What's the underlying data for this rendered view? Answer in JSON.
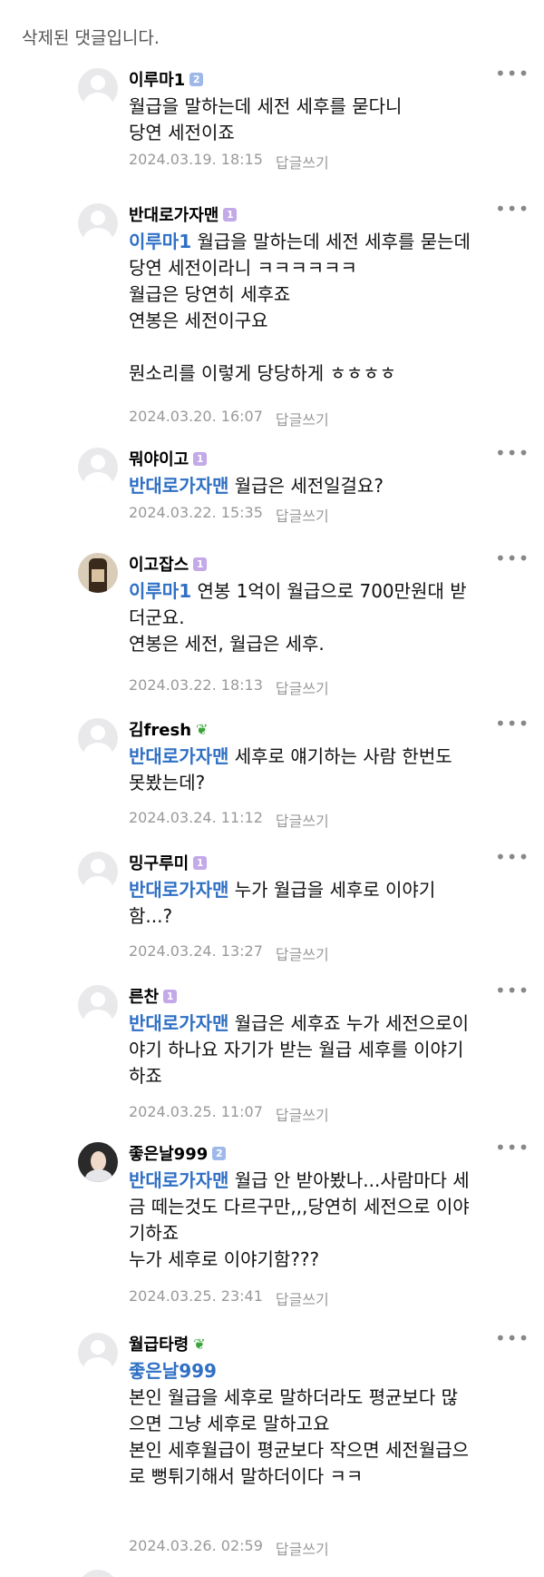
{
  "deleted_notice": "삭제된 댓글입니다.",
  "more_label": "•••",
  "reply_label": "답글쓰기",
  "comments": [
    {
      "nick": "이루마1",
      "badge": "2",
      "mention": "",
      "text": "월급을 말하는데 세전 세후를 묻다니\n당연 세전이죠",
      "date": "2024.03.19. 18:15"
    },
    {
      "nick": "반대로가자맨",
      "badge": "1",
      "mention": "이루마1",
      "text": " 월급을 말하는데 세전 세후를 묻는데\n당연 세전이라니 ㅋㅋㅋㅋㅋㅋ\n월급은 당연히 세후죠\n연봉은 세전이구요\n\n뭔소리를 이렇게 당당하게 ㅎㅎㅎㅎ",
      "date": "2024.03.20. 16:07"
    },
    {
      "nick": "뭐야이고",
      "badge": "1",
      "mention": "반대로가자맨",
      "text": " 월급은 세전일걸요?",
      "date": "2024.03.22. 15:35"
    },
    {
      "nick": "이고잡스",
      "badge": "1",
      "mention": "이루마1",
      "text": " 연봉 1억이 월급으로 700만원대 받\n더군요.\n연봉은 세전, 월급은 세후.",
      "date": "2024.03.22. 18:13"
    },
    {
      "nick": "김fresh",
      "badge": "sprout",
      "mention": "반대로가자맨",
      "text": " 세후로 얘기하는 사람 한번도\n못봤는데?",
      "date": "2024.03.24. 11:12"
    },
    {
      "nick": "밍구루미",
      "badge": "1",
      "mention": "반대로가자맨",
      "text": " 누가 월급을 세후로 이야기\n함...?",
      "date": "2024.03.24. 13:27"
    },
    {
      "nick": "른찬",
      "badge": "1",
      "mention": "반대로가자맨",
      "text": " 월급은 세후죠 누가 세전으로이\n야기 하나요 자기가 받는 월급 세후를 이야기\n하죠",
      "date": "2024.03.25. 11:07"
    },
    {
      "nick": "좋은날999",
      "badge": "2",
      "mention": "반대로가자맨",
      "text": " 월급 안 받아봤나...사람마다 세\n금 떼는것도 다르구만,,,당연히 세전으로 이야\n기하죠\n누가 세후로 이야기함???",
      "date": "2024.03.25. 23:41"
    },
    {
      "nick": "월급타령",
      "badge": "sprout",
      "mention": "좋은날999",
      "text": "\n본인 월급을 세후로 말하더라도 평균보다 많\n으면 그냥 세후로 말하고요\n본인 세후월급이 평균보다 작으면 세전월급으\n로 뻥튀기해서 말하더이다 ㅋㅋ\n",
      "date": "2024.03.26. 02:59"
    }
  ]
}
